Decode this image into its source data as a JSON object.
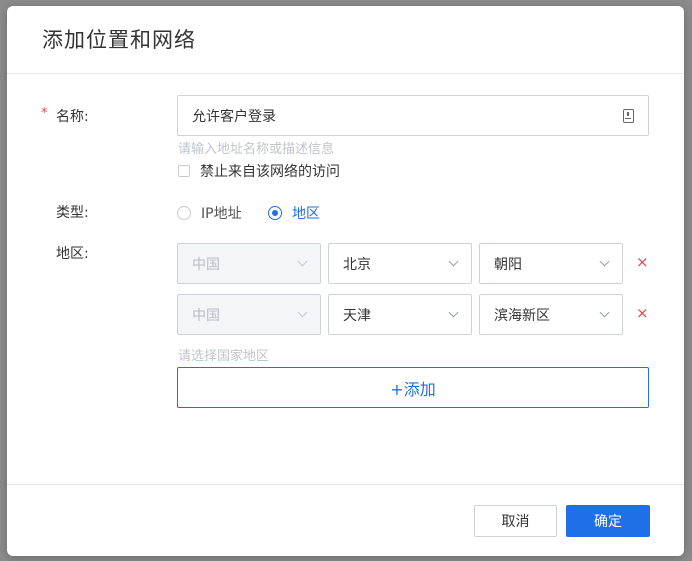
{
  "dialog": {
    "title": "添加位置和网络"
  },
  "form": {
    "name": {
      "required_mark": "*",
      "label": "名称:",
      "value": "允许客户登录",
      "hint": "请输入地址名称或描述信息",
      "deny_label": "禁止来自该网络的访问",
      "deny_checked": false
    },
    "type": {
      "label": "类型:",
      "options": [
        {
          "label": "IP地址",
          "selected": false
        },
        {
          "label": "地区",
          "selected": true
        }
      ]
    },
    "region": {
      "label": "地区:",
      "rows": [
        {
          "country": "中国",
          "province": "北京",
          "city": "朝阳",
          "remove": "×"
        },
        {
          "country": "中国",
          "province": "天津",
          "city": "滨海新区",
          "remove": "×"
        }
      ],
      "hint": "请选择国家地区",
      "add_label": "+添加"
    }
  },
  "footer": {
    "cancel_label": "取消",
    "ok_label": "确定"
  },
  "colors": {
    "primary": "#1f6fe6",
    "danger": "#e5484d"
  }
}
